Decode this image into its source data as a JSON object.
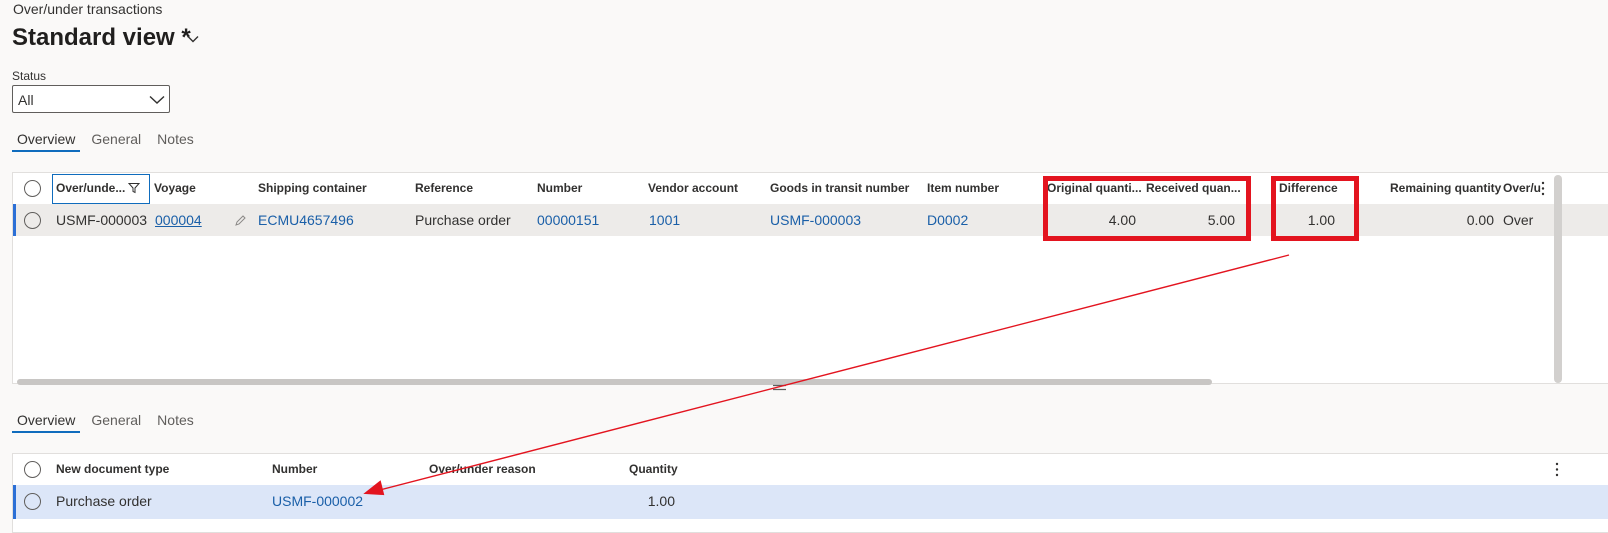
{
  "breadcrumb": "Over/under transactions",
  "view": {
    "title": "Standard view *"
  },
  "status_filter": {
    "label": "Status",
    "value": "All"
  },
  "top_tabs": [
    "Overview",
    "General",
    "Notes"
  ],
  "top_grid": {
    "columns": [
      "Over/unde...",
      "Voyage",
      "Shipping container",
      "Reference",
      "Number",
      "Vendor account",
      "Goods in transit number",
      "Item number",
      "Original quanti...",
      "Received quan...",
      "Difference",
      "Remaining quantity",
      "Over/u"
    ],
    "row": {
      "id": "USMF-000003",
      "voyage": "000004",
      "shipping_container": "ECMU4657496",
      "reference": "Purchase order",
      "number": "00000151",
      "vendor_account": "1001",
      "goods_in_transit": "USMF-000003",
      "item_number": "D0002",
      "original_qty": "4.00",
      "received_qty": "5.00",
      "difference": "1.00",
      "remaining_qty": "0.00",
      "over_under": "Over"
    }
  },
  "bottom_tabs": [
    "Overview",
    "General",
    "Notes"
  ],
  "bottom_grid": {
    "columns": [
      "New document type",
      "Number",
      "Over/under reason",
      "Quantity"
    ],
    "row": {
      "doc_type": "Purchase order",
      "number": "USMF-000002",
      "reason": "",
      "quantity": "1.00"
    }
  },
  "colors": {
    "annotation_red": "#e3141f",
    "link_blue": "#1a5fa8",
    "selected_row_bg": "#dce6f8",
    "accent": "#0f6cbd"
  }
}
